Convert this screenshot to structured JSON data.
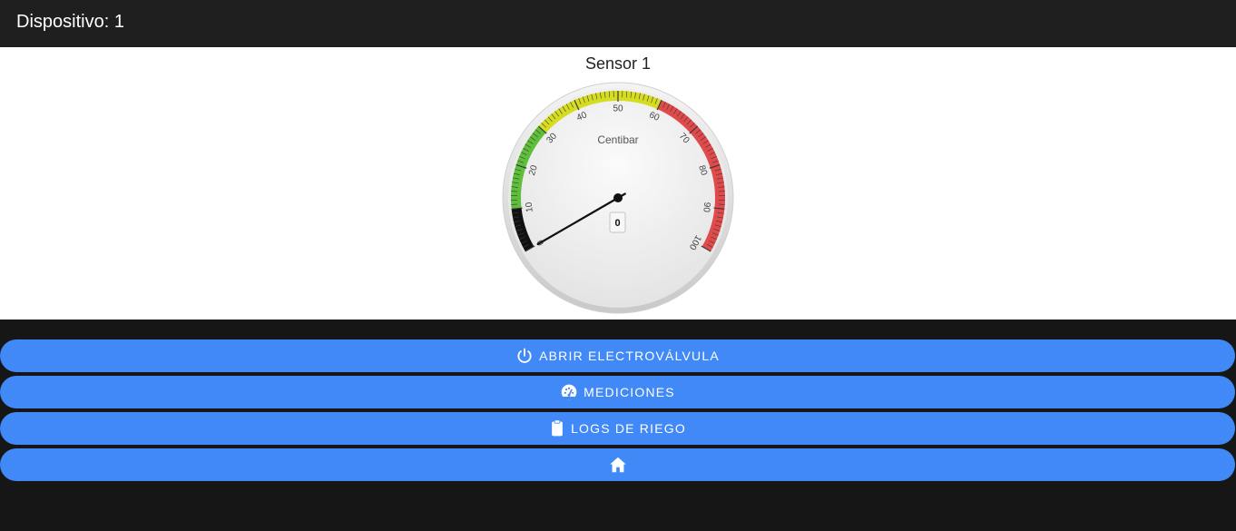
{
  "header": {
    "title": "Dispositivo: 1"
  },
  "sensor": {
    "title": "Sensor 1",
    "gauge": {
      "units": "Centibar",
      "min": 0,
      "max": 100,
      "value": 0,
      "value_label": "0",
      "major_ticks": [
        "0",
        "10",
        "20",
        "30",
        "40",
        "50",
        "60",
        "70",
        "80",
        "90",
        "100"
      ],
      "zones": [
        {
          "from": 0,
          "to": 10,
          "color": "#111111"
        },
        {
          "from": 10,
          "to": 30,
          "color": "#5fbf3a"
        },
        {
          "from": 30,
          "to": 60,
          "color": "#d6dc1f"
        },
        {
          "from": 60,
          "to": 100,
          "color": "#e04a4a"
        }
      ]
    }
  },
  "buttons": {
    "open_valve": {
      "label": "ABRIR ELECTROVÁLVULA",
      "icon": "power-icon"
    },
    "measurements": {
      "label": "MEDICIONES",
      "icon": "speedometer-icon"
    },
    "irrigation_logs": {
      "label": "LOGS DE RIEGO",
      "icon": "clipboard-icon"
    },
    "home": {
      "icon": "home-icon"
    }
  },
  "colors": {
    "header_bg": "#1f1f1f",
    "page_bg": "#161616",
    "button_bg": "#4189f6"
  }
}
